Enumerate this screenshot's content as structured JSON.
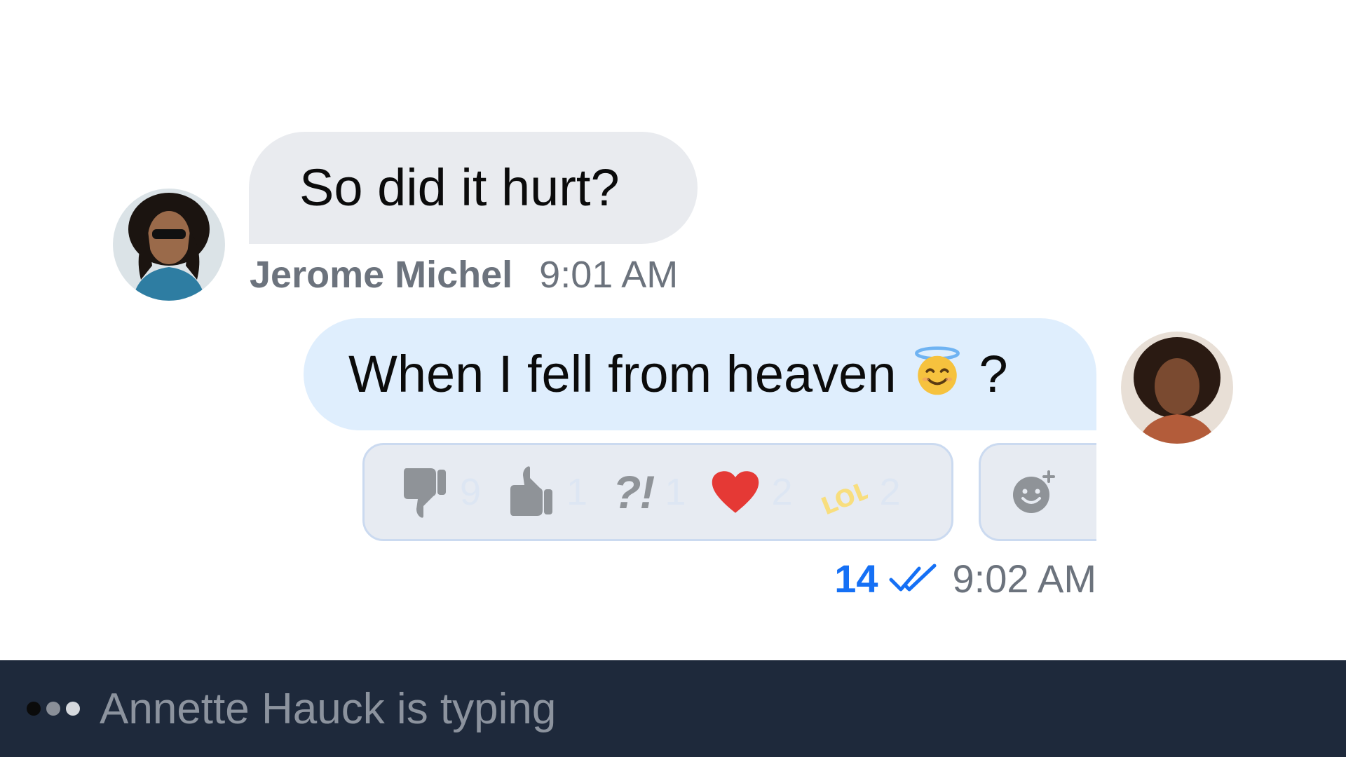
{
  "messages": [
    {
      "text": "So did it hurt?",
      "sender": "Jerome Michel",
      "time": "9:01 AM",
      "direction": "incoming",
      "avatar_icon": "avatar-jerome"
    },
    {
      "text_before": "When I fell from heaven",
      "emoji": "smiling-face-with-halo-icon",
      "text_after": "?",
      "time": "9:02 AM",
      "read_count": "14",
      "read_icon": "double-check-icon",
      "direction": "outgoing",
      "avatar_icon": "avatar-annette"
    }
  ],
  "reactions": [
    {
      "icon": "thumbs-down-icon",
      "count": "9"
    },
    {
      "icon": "thumbs-up-icon",
      "count": "1"
    },
    {
      "icon": "interrobang-icon",
      "label": "?!",
      "count": "1"
    },
    {
      "icon": "heart-icon",
      "count": "2"
    },
    {
      "icon": "lol-icon",
      "label": "LOL",
      "count": "2"
    }
  ],
  "add_reaction_icon": "add-emoji-icon",
  "typing": {
    "text": "Annette Hauck is typing"
  },
  "colors": {
    "incoming_bubble": "#e9ebef",
    "outgoing_bubble": "#dfeefd",
    "reaction_bg": "#e7ebf2",
    "reaction_border": "#cbdaf0",
    "read_accent": "#1570f5",
    "meta_text": "#6c737d",
    "typing_bar": "#1e293b",
    "heart": "#e53935"
  }
}
